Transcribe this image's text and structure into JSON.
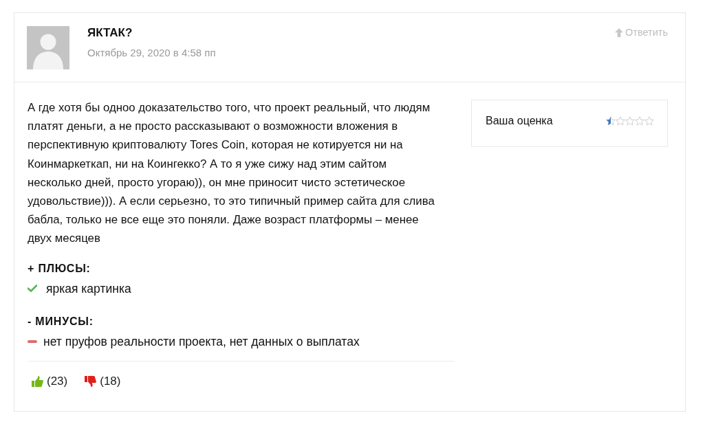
{
  "comment": {
    "author": "ЯКТАК?",
    "date": "Октябрь 29, 2020 в 4:58 пп",
    "reply": "Ответить",
    "text": "А где хотя бы одноо доказательство того, что проект реальный, что людям платят деньги, а не просто рассказывают о возможности вложения в перспективную криптовалюту Tores Coin, которая не котируется ни на Коинмаркеткап, ни на Коингекко? А то я уже сижу над этим сайтом несколько дней, просто угораю)), он мне приносит чисто эстетическое удовольствие))). А если серьезно, то это типичный пример сайта для слива бабла, только не все еще это поняли. Даже возраст платформы – менее двух месяцев",
    "rating": {
      "label": "Ваша оценка",
      "stars": 0.5
    },
    "pros": {
      "heading": "+ ПЛЮСЫ:",
      "items": [
        "яркая картинка"
      ]
    },
    "cons": {
      "heading": "- МИНУСЫ:",
      "items": [
        "нет пруфов реальности проекта, нет данных о выплатах"
      ]
    },
    "votes": [
      {
        "kind": "up",
        "count": "(23)"
      },
      {
        "kind": "down",
        "count": "(18)"
      }
    ]
  }
}
